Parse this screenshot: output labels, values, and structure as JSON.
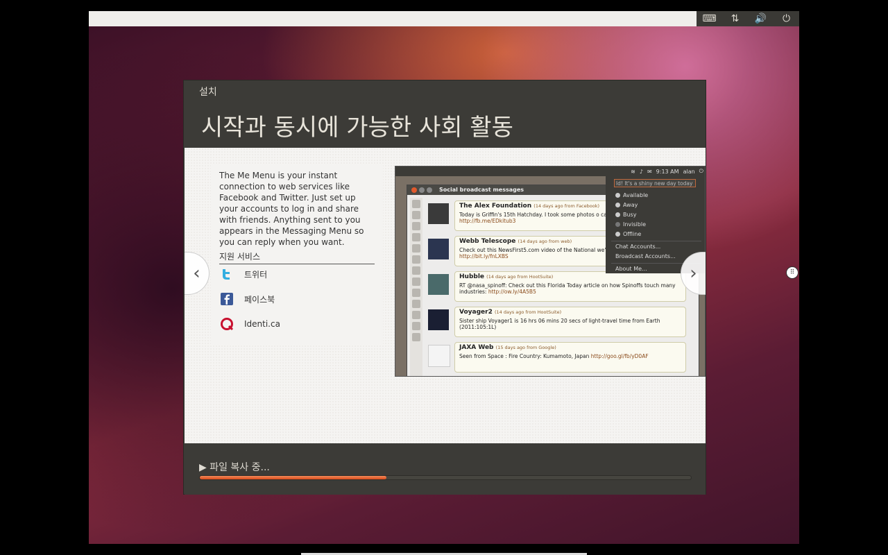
{
  "indicators": {
    "keyboard": "⌨",
    "network": "⇅",
    "volume": "🔊",
    "power": "⏻"
  },
  "window": {
    "title": "설치",
    "headline": "시작과 동시에 가능한 사회 활동"
  },
  "slide": {
    "description": "The Me Menu is your instant connection to web services like Facebook and Twitter. Just set up your accounts to log in and share with friends. Anything sent to you appears in the Messaging Menu so you can reply when you want.",
    "services_heading": "지원 서비스",
    "services": [
      {
        "name": "트위터",
        "icon": "twitter-icon"
      },
      {
        "name": "페이스북",
        "icon": "facebook-icon"
      },
      {
        "name": "Identi.ca",
        "icon": "identica-icon"
      }
    ],
    "prev": "‹",
    "next": "›"
  },
  "screenshot": {
    "panel": {
      "time": "9:13 AM",
      "user": "alan"
    },
    "window_title": "Social broadcast messages",
    "messages": [
      {
        "name": "The Alex Foundation",
        "source": "(14 days ago from Facebook)",
        "text": "Today is Griffin's 15th Hatchday. I took some photos o cards that he received today.",
        "link": "http://fb.me/EDkitub3"
      },
      {
        "name": "Webb Telescope",
        "source": "(14 days ago from web)",
        "text": "Check out this NewsFirst5.com video of the National we're covered at the beginning!",
        "link": "http://bit.ly/fnLXBS"
      },
      {
        "name": "Hubble",
        "source": "(14 days ago from HootSuite)",
        "text": "RT @nasa_spinoff: Check out this Florida Today article on how Spinoffs touch many industries:",
        "link": "http://ow.ly/4A5B5"
      },
      {
        "name": "Voyager2",
        "source": "(14 days ago from HootSuite)",
        "text": "Sister ship Voyager1 is 16 hrs 06 mins 20 secs of light-travel time from Earth (2011:105:1L)",
        "link": ""
      },
      {
        "name": "JAXA Web",
        "source": "(15 days ago from Google)",
        "text": "Seen from Space : Fire Country: Kumamoto, Japan",
        "link": "http://goo.gl/fb/yD0AF"
      }
    ],
    "me_menu": {
      "status_input": "ld! It's a shiny new day today",
      "statuses": [
        "Available",
        "Away",
        "Busy",
        "Invisible",
        "Offline"
      ],
      "items": [
        "Chat Accounts...",
        "Broadcast Accounts...",
        "About Me..."
      ]
    }
  },
  "progress": {
    "status": "▶ 파일 복사 중...",
    "fraction": 0.38,
    "color": "#dd4b1a"
  }
}
